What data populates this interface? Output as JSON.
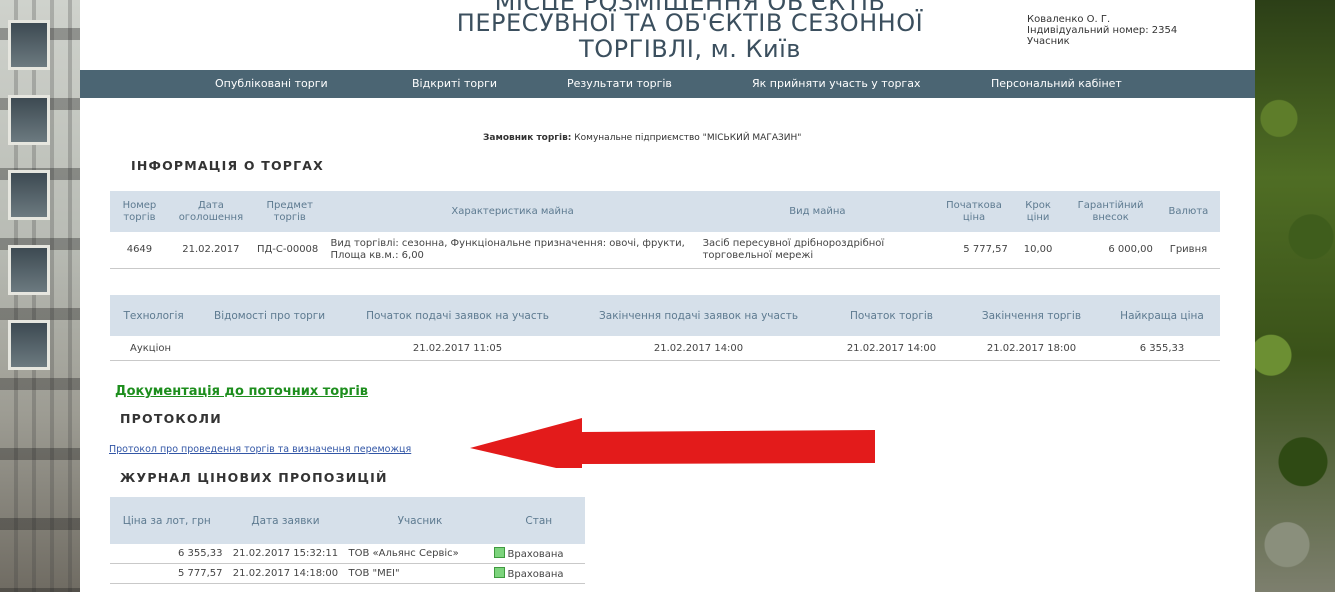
{
  "header": {
    "title_cut": "МІСЦЕ РОЗМІЩЕННЯ ОБ'ЄКТІВ",
    "title_line1": "ПЕРЕСУВНОЇ ТА ОБ'ЄКТІВ СЕЗОННОЇ",
    "title_line2": "ТОРГІВЛІ, м. Київ",
    "user_name": "Коваленко О. Г.",
    "user_id": "Індивідуальний номер: 2354",
    "user_role": "Учасник"
  },
  "nav": [
    "Опубліковані торги",
    "Відкриті торги",
    "Результати торгів",
    "Як прийняти участь у торгах",
    "Персональний кабінет"
  ],
  "customer": {
    "label": "Замовник торгів:",
    "value": "Комунальне підприємство \"МІСЬКИЙ МАГАЗИН\""
  },
  "info": {
    "heading": "ІНФОРМАЦІЯ О ТОРГАХ",
    "headers": [
      "Номер торгів",
      "Дата оголошення",
      "Предмет торгів",
      "Характеристика майна",
      "Вид майна",
      "Початкова ціна",
      "Крок ціни",
      "Гарантійний внесок",
      "Валюта"
    ],
    "row": [
      "4649",
      "21.02.2017",
      "ПД-С-00008",
      "Вид торгівлі: сезонна, Функціональне призначення: овочі, фрукти, Площа кв.м.: 6,00",
      "Засіб пересувної дрібнороздрібної торговельної мережі",
      "5 777,57",
      "10,00",
      "6 000,00",
      "Гривня"
    ]
  },
  "tech": {
    "headers": [
      "Технологія",
      "Відомості про торги",
      "Початок подачі заявок на участь",
      "Закінчення подачі заявок на участь",
      "Початок торгів",
      "Закінчення торгів",
      "Найкраща ціна"
    ],
    "row": [
      "Аукціон",
      "",
      "21.02.2017 11:05",
      "21.02.2017 14:00",
      "21.02.2017 14:00",
      "21.02.2017 18:00",
      "6 355,33"
    ]
  },
  "doc_link": "Документація до поточних торгів",
  "protocols": {
    "heading": "ПРОТОКОЛИ",
    "link": "Протокол про проведення торгів та визначення переможця"
  },
  "journal": {
    "heading": "ЖУРНАЛ ЦІНОВИХ ПРОПОЗИЦІЙ",
    "headers": [
      "Ціна за лот, грн",
      "Дата заявки",
      "Учасник",
      "Стан"
    ],
    "rows": [
      [
        "6 355,33",
        "21.02.2017 15:32:11",
        "ТОВ «Альянс Сервіс»",
        "Врахована"
      ],
      [
        "5 777,57",
        "21.02.2017 14:18:00",
        "ТОВ \"МЕІ\"",
        "Врахована"
      ]
    ]
  },
  "colors": {
    "nav_bg": "#4b6573",
    "table_header_bg": "#d6e0ea",
    "link_green": "#1d8e1d",
    "link_blue": "#3256a6",
    "arrow_red": "#e31b1b",
    "status_green": "#7cd37c"
  }
}
